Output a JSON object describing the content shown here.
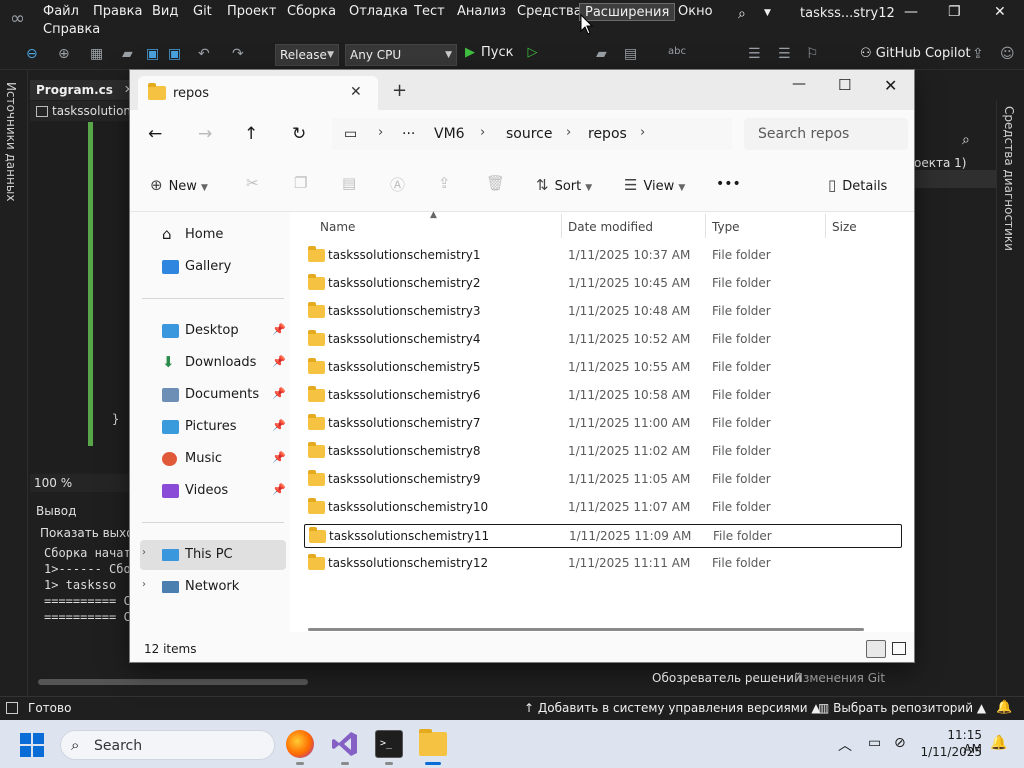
{
  "vs": {
    "menu": [
      "Файл",
      "Правка",
      "Вид",
      "Git",
      "Проект",
      "Сборка",
      "Отладка",
      "Тест",
      "Анализ",
      "Средства",
      "Расширения",
      "Окно"
    ],
    "menu_second_row": "Справка",
    "title": "taskss...stry12",
    "toolbar": {
      "config": "Release",
      "platform": "Any CPU",
      "run": "Пуск",
      "copilot": "GitHub Copilot"
    },
    "left_strip": "Источники данных",
    "right_strip": "Средства диагностики",
    "editor": {
      "tab": "Program.cs",
      "nav": "taskssolutions",
      "brace": "}",
      "zoom": "100 %"
    },
    "output": {
      "title": "Вывод",
      "show_label": "Показать выход",
      "lines": [
        "Сборка начат",
        "1>------ Сбо",
        "1>  tasksso",
        "========== С",
        "========== С"
      ]
    },
    "right_panel": {
      "text": "оекта 1)"
    },
    "bottom_tabs": {
      "solution": "Обозреватель решений",
      "git": "Изменения Git"
    },
    "status": {
      "ready": "Готово",
      "git": "Добавить в систему управления версиями",
      "repo": "Выбрать репозиторий"
    }
  },
  "explorer": {
    "tab_title": "repos",
    "breadcrumb": [
      "VM6",
      "source",
      "repos"
    ],
    "search_placeholder": "Search repos",
    "commands": {
      "new": "New",
      "sort": "Sort",
      "view": "View",
      "more": "•••",
      "details": "Details"
    },
    "nav": {
      "home": "Home",
      "gallery": "Gallery",
      "pinned": [
        "Desktop",
        "Downloads",
        "Documents",
        "Pictures",
        "Music",
        "Videos"
      ],
      "this_pc": "This PC",
      "network": "Network"
    },
    "columns": {
      "name": "Name",
      "date": "Date modified",
      "type": "Type",
      "size": "Size"
    },
    "rows": [
      {
        "name": "taskssolutionschemistry1",
        "date": "1/11/2025 10:37 AM",
        "type": "File folder"
      },
      {
        "name": "taskssolutionschemistry2",
        "date": "1/11/2025 10:45 AM",
        "type": "File folder"
      },
      {
        "name": "taskssolutionschemistry3",
        "date": "1/11/2025 10:48 AM",
        "type": "File folder"
      },
      {
        "name": "taskssolutionschemistry4",
        "date": "1/11/2025 10:52 AM",
        "type": "File folder"
      },
      {
        "name": "taskssolutionschemistry5",
        "date": "1/11/2025 10:55 AM",
        "type": "File folder"
      },
      {
        "name": "taskssolutionschemistry6",
        "date": "1/11/2025 10:58 AM",
        "type": "File folder"
      },
      {
        "name": "taskssolutionschemistry7",
        "date": "1/11/2025 11:00 AM",
        "type": "File folder"
      },
      {
        "name": "taskssolutionschemistry8",
        "date": "1/11/2025 11:02 AM",
        "type": "File folder"
      },
      {
        "name": "taskssolutionschemistry9",
        "date": "1/11/2025 11:05 AM",
        "type": "File folder"
      },
      {
        "name": "taskssolutionschemistry10",
        "date": "1/11/2025 11:07 AM",
        "type": "File folder"
      },
      {
        "name": "taskssolutionschemistry11",
        "date": "1/11/2025 11:09 AM",
        "type": "File folder"
      },
      {
        "name": "taskssolutionschemistry12",
        "date": "1/11/2025 11:11 AM",
        "type": "File folder"
      }
    ],
    "item_count": "12 items"
  },
  "taskbar": {
    "search_label": "Search",
    "time": "11:15 AM",
    "date": "1/11/2025"
  },
  "colors": {
    "folder": "#f5c242",
    "vs_purple": "#8661c5",
    "windows_blue": "#0a6cd6"
  }
}
